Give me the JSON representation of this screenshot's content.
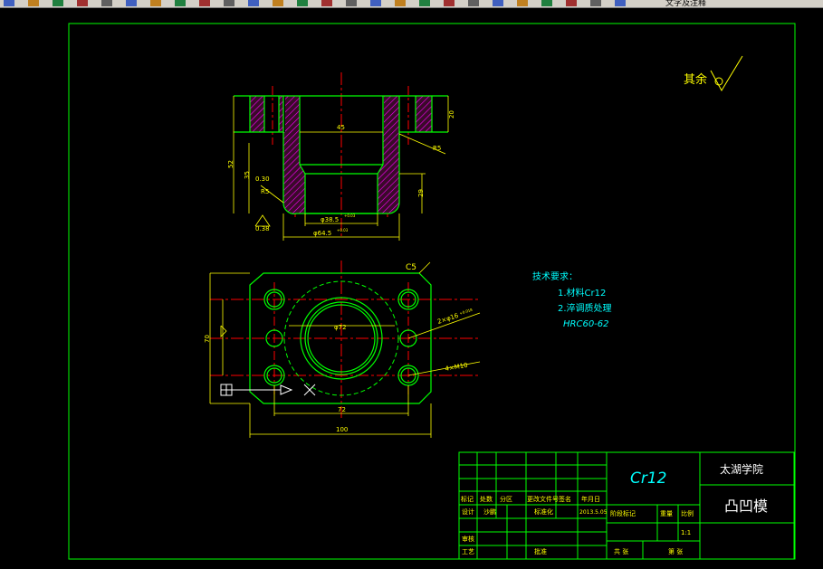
{
  "toolbar": {
    "label": "文字及注释",
    "buttons": [
      "open-icon",
      "save-icon",
      "print-icon",
      "preview-icon",
      "cut-icon",
      "copy-icon",
      "paste-icon",
      "match-icon",
      "undo-icon",
      "redo-icon",
      "pan-icon",
      "zoom-realtime-icon",
      "zoom-window-icon",
      "zoom-previous-icon",
      "zoom-extents-icon",
      "properties-icon",
      "designcenter-icon",
      "tool-palettes-icon",
      "sheetset-icon",
      "markup-icon",
      "calculator-icon",
      "help-icon",
      "layer-icon",
      "layer-state-icon",
      "layer-prev-icon",
      "style-icon"
    ]
  },
  "drawing": {
    "roughness": "其余",
    "section": {
      "dim_45": "45",
      "dim_20": "20",
      "dim_r5": "R5",
      "dim_r5_lower": "R5",
      "dim_52": "52",
      "dim_35": "35",
      "dim_030": "0.30",
      "dim_29": "29",
      "dim_038": "0.38",
      "dim_phi38": "φ38.5",
      "dim_phi38_tol": "+0.03",
      "dim_phi64": "φ64.5",
      "dim_phi64_tol": "+0.03"
    },
    "plan": {
      "chamfer": "C5",
      "dim_phi72": "φ72",
      "dim_2phi16": "2×φ16",
      "dim_2phi16_tol": "+0.018",
      "dim_4m10": "4×M10",
      "dim_70": "70",
      "dim_72": "72",
      "dim_100": "100"
    },
    "notes": {
      "title": "技术要求：",
      "items": [
        "1.材料Cr12",
        "2.淬调质处理",
        "HRC60-62"
      ]
    }
  },
  "title_block": {
    "material": "Cr12",
    "school": "太湖学院",
    "part_name": "凸凹模",
    "header_row": [
      "标记",
      "处数",
      "分区",
      "更改文件号",
      "签名",
      "年月日"
    ],
    "design_label": "设计",
    "designer": "沙鹏",
    "standard_label": "标准化",
    "date": "2013.5.05",
    "stage_label": "阶段标记",
    "weight_label": "重量",
    "scale_label": "比例",
    "scale": "1:1",
    "check_label": "审核",
    "process_label": "工艺",
    "approve_label": "批准",
    "sheets_label": "共 张",
    "sheet_label": "第 张"
  }
}
